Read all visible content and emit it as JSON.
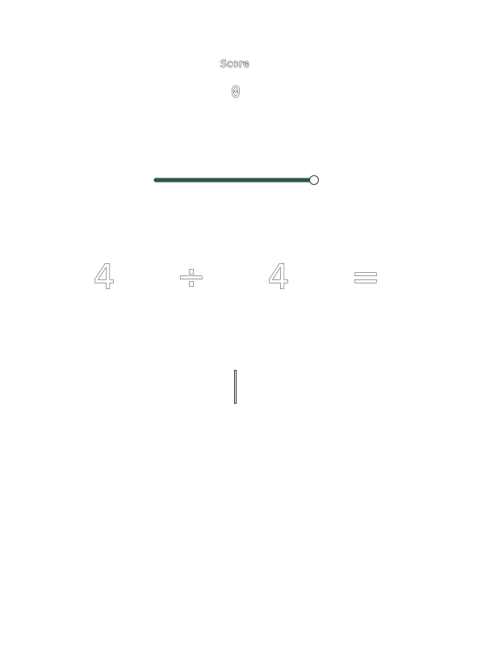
{
  "score": {
    "label": "Score",
    "value": "0"
  },
  "timer": {
    "remaining_fraction": 1.0,
    "bar_color": "#1c3b2c"
  },
  "equation": {
    "operand_a": "4",
    "operator": "÷",
    "operand_b": "4",
    "equals": "="
  },
  "answer": {
    "value": ""
  },
  "colors": {
    "background": "#ffffff",
    "text_outline": "#3a3a3a",
    "timer_bar": "#1c3b2c"
  }
}
